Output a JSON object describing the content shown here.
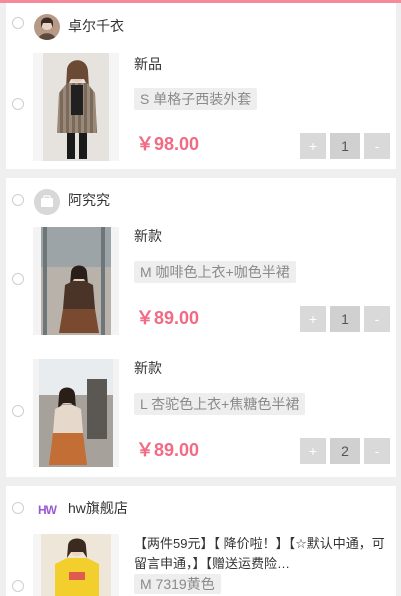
{
  "accent": "#f26a83",
  "stores": [
    {
      "name": "卓尔千衣",
      "items": [
        {
          "tag": "新品",
          "spec": "S 单格子西装外套",
          "price": "￥98.00",
          "qty": "1"
        }
      ]
    },
    {
      "name": "阿究究",
      "items": [
        {
          "tag": "新款",
          "spec": "M 咖啡色上衣+咖色半裙",
          "price": "￥89.00",
          "qty": "1"
        },
        {
          "tag": "新款",
          "spec": "L 杏驼色上衣+焦糖色半裙",
          "price": "￥89.00",
          "qty": "2"
        }
      ]
    },
    {
      "name": "hw旗舰店",
      "logo_text": "HW",
      "items": [
        {
          "title": "【两件59元】【 降价啦！】【☆默认中通，可留言申通，】【赠送运费险…",
          "spec": "M 7319黄色"
        }
      ]
    }
  ],
  "stepper": {
    "plus": "+",
    "minus": "-"
  },
  "icons": {
    "avatar2": "bag-icon"
  }
}
